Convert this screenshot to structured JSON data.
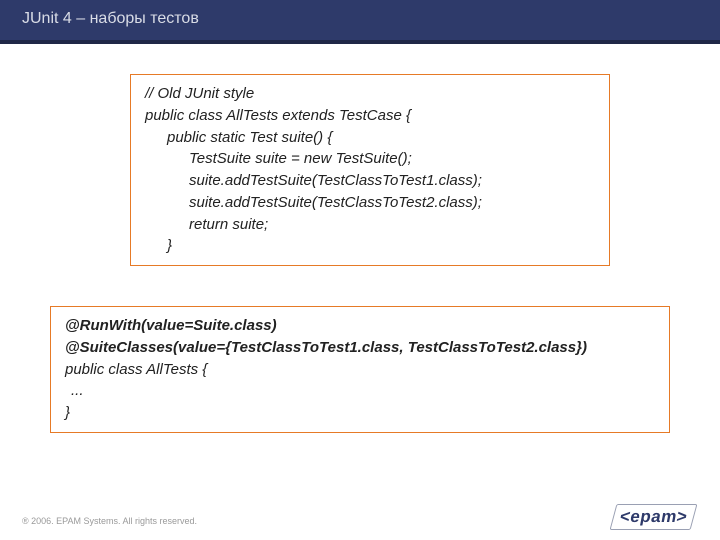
{
  "title": "JUnit 4 – наборы тестов",
  "box1": {
    "l1": "// Old JUnit style",
    "l2": "public class AllTests extends TestCase {",
    "l3": "",
    "l4": "public static Test suite() {",
    "l5": "TestSuite suite = new TestSuite();",
    "l6": "suite.addTestSuite(TestClassToTest1.class);",
    "l7": "suite.addTestSuite(TestClassToTest2.class);",
    "l8": "return suite;",
    "l9": "}"
  },
  "box2": {
    "l1": "@RunWith(value=Suite.class)",
    "l2": "@SuiteClasses(value={TestClassToTest1.class, TestClassToTest2.class})",
    "l3": "public class AllTests {",
    "l4": "...",
    "l5": "}"
  },
  "footer": "® 2006. EPAM Systems. All rights reserved.",
  "logo": "<epam>"
}
